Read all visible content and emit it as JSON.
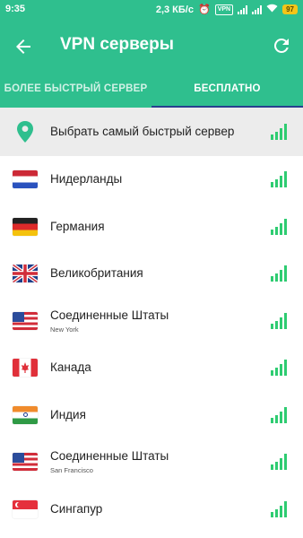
{
  "status_bar": {
    "time": "9:35",
    "speed": "2,3 КБ/с",
    "vpn": "VPN",
    "battery": "97"
  },
  "app_bar": {
    "title": "VPN серверы",
    "back_icon": "arrow-back-icon",
    "refresh_icon": "refresh-icon"
  },
  "tabs": [
    {
      "label": "БОЛЕЕ БЫСТРЫЙ СЕРВЕР",
      "active": false
    },
    {
      "label": "БЕСПЛАТНО",
      "active": true
    }
  ],
  "colors": {
    "accent": "#2fbf8e",
    "tab_indicator": "#26408f",
    "signal": "#2ecc71",
    "selected_row": "#ececec"
  },
  "servers": [
    {
      "name": "Выбрать самый быстрый сервер",
      "sub": "",
      "icon": "location-pin-icon"
    },
    {
      "name": "Нидерланды",
      "sub": "",
      "icon": "flag-netherlands-icon"
    },
    {
      "name": "Германия",
      "sub": "",
      "icon": "flag-germany-icon"
    },
    {
      "name": "Великобритания",
      "sub": "",
      "icon": "flag-uk-icon"
    },
    {
      "name": "Соединенные Штаты",
      "sub": "New York",
      "icon": "flag-usa-icon"
    },
    {
      "name": "Канада",
      "sub": "",
      "icon": "flag-canada-icon"
    },
    {
      "name": "Индия",
      "sub": "",
      "icon": "flag-india-icon"
    },
    {
      "name": "Соединенные Штаты",
      "sub": "San Francisco",
      "icon": "flag-usa-icon"
    },
    {
      "name": "Сингапур",
      "sub": "",
      "icon": "flag-singapore-icon"
    }
  ]
}
